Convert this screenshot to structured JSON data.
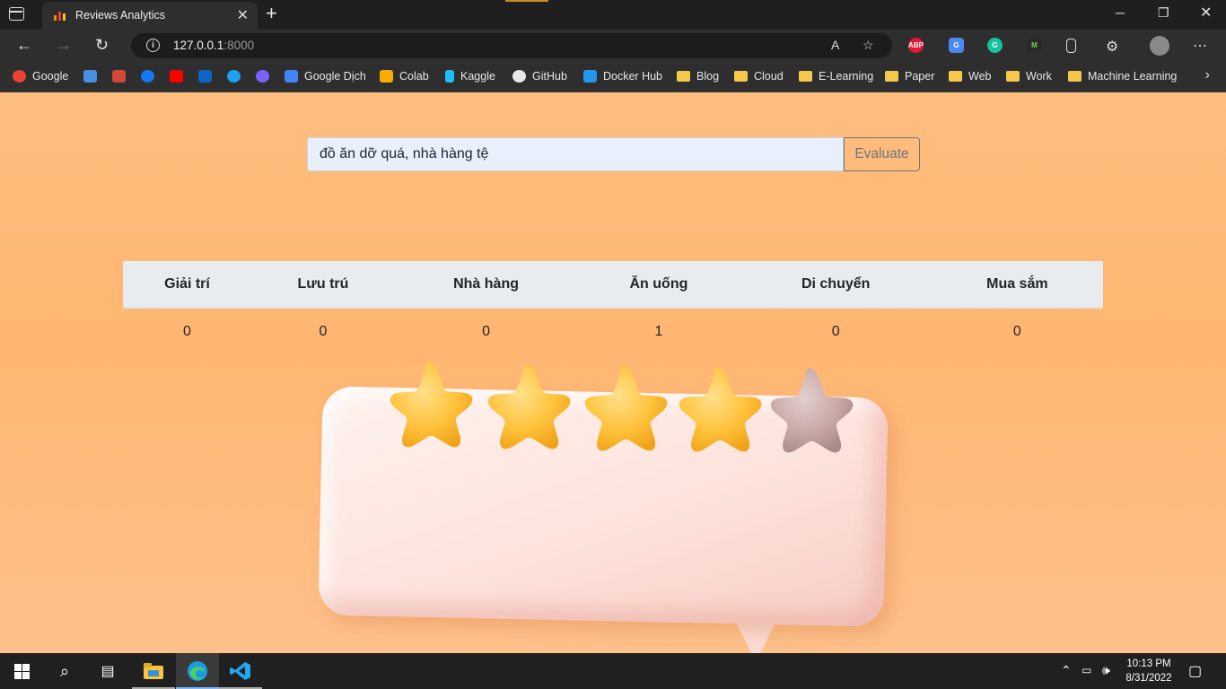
{
  "browser": {
    "tab_title": "Reviews Analytics",
    "url_host": "127.0.0.1",
    "url_port": ":8000",
    "bookmarks": [
      {
        "label": "Google",
        "color": "#ea4335"
      },
      {
        "label": "",
        "color": "#4a90e2"
      },
      {
        "label": "",
        "color": "#d44638"
      },
      {
        "label": "",
        "color": "#1877f2"
      },
      {
        "label": "",
        "color": "#ff0000"
      },
      {
        "label": "",
        "color": "#0a66c2"
      },
      {
        "label": "",
        "color": "#1da1f2"
      },
      {
        "label": "",
        "color": "#7b61ff"
      },
      {
        "label": "Google Dịch",
        "color": "#4285f4"
      },
      {
        "label": "Colab",
        "color": "#f9ab00"
      },
      {
        "label": "Kaggle",
        "color": "#20beff"
      },
      {
        "label": "GitHub",
        "color": "#e8e8e8"
      },
      {
        "label": "Docker Hub",
        "color": "#2496ed"
      },
      {
        "label": "Blog",
        "folder": true
      },
      {
        "label": "Cloud",
        "folder": true
      },
      {
        "label": "E-Learning",
        "folder": true
      },
      {
        "label": "Paper",
        "folder": true
      },
      {
        "label": "Web",
        "folder": true
      },
      {
        "label": "Work",
        "folder": true
      },
      {
        "label": "Machine Learning",
        "folder": true
      }
    ],
    "extensions": [
      "ABP"
    ]
  },
  "search": {
    "value": "đồ ăn dỡ quá, nhà hàng tệ",
    "button_label": "Evaluate"
  },
  "results": {
    "headers": [
      "Giải trí",
      "Lưu trú",
      "Nhà hàng",
      "Ăn uống",
      "Di chuyển",
      "Mua sắm"
    ],
    "values": [
      "0",
      "0",
      "0",
      "1",
      "0",
      "0"
    ]
  },
  "illustration": {
    "rating_filled": 4,
    "rating_max": 5,
    "star_color": "#ffc23b",
    "empty_star_color": "#c9a9a6"
  },
  "taskbar": {
    "time": "10:13 PM",
    "date": "8/31/2022"
  }
}
